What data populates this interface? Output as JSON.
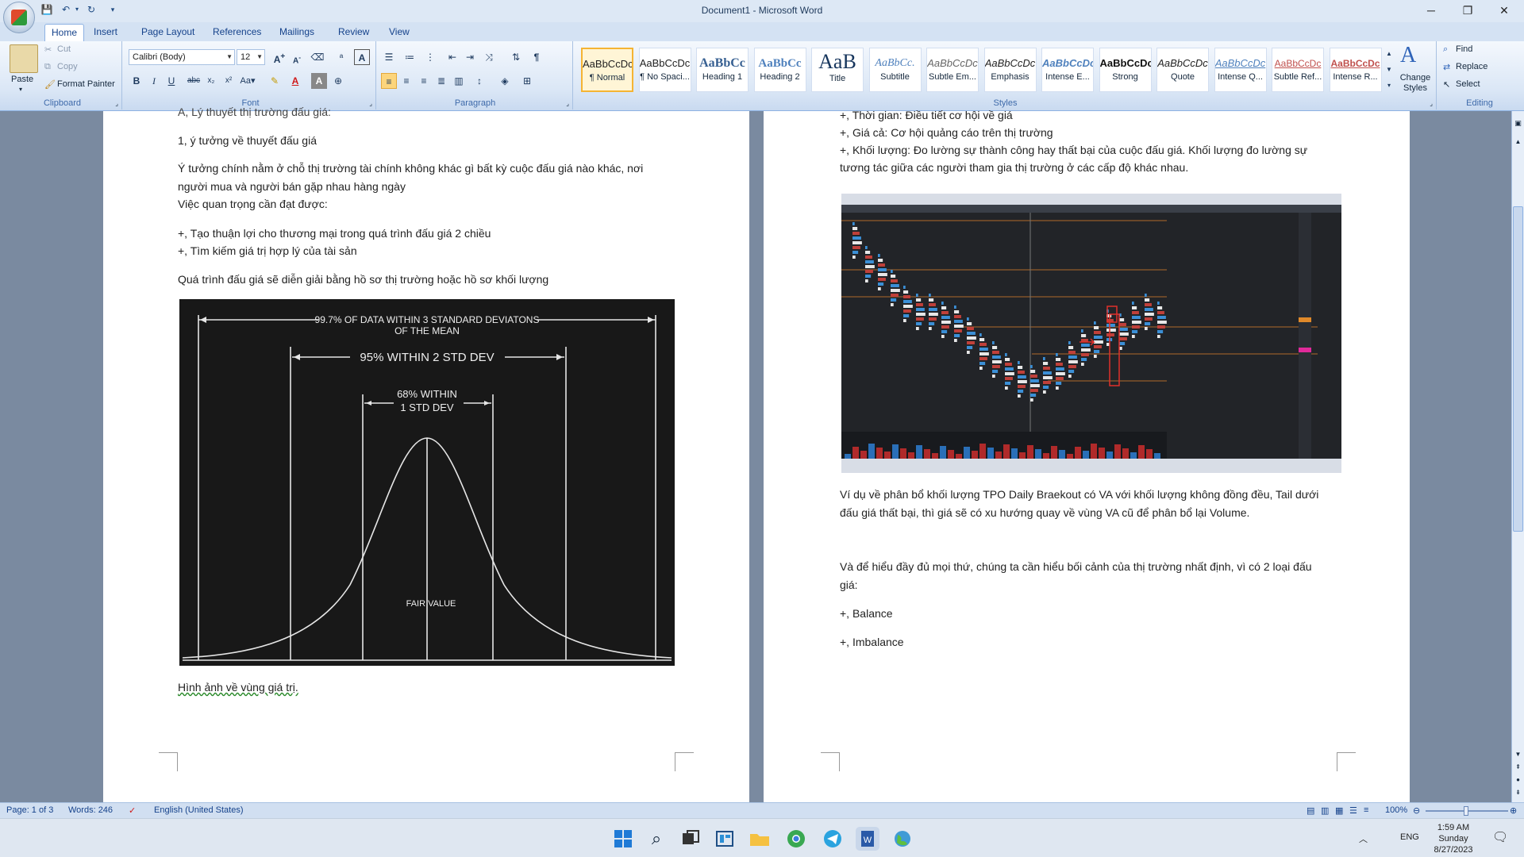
{
  "window": {
    "title": "Document1 - Microsoft Word",
    "minimize": "─",
    "restore": "❐",
    "close": "✕"
  },
  "tabs": [
    "Home",
    "Insert",
    "Page Layout",
    "References",
    "Mailings",
    "Review",
    "View"
  ],
  "clipboard": {
    "label": "Clipboard",
    "paste": "Paste",
    "cut": "Cut",
    "copy": "Copy",
    "format_painter": "Format Painter"
  },
  "font": {
    "label": "Font",
    "name": "Calibri (Body)",
    "size": "12"
  },
  "paragraph": {
    "label": "Paragraph"
  },
  "styles": {
    "label": "Styles",
    "change_styles": "Change Styles",
    "items": [
      {
        "preview": "AaBbCcDc",
        "name": "¶ Normal"
      },
      {
        "preview": "AaBbCcDc",
        "name": "¶ No Spaci..."
      },
      {
        "preview": "AaBbCc",
        "name": "Heading 1"
      },
      {
        "preview": "AaBbCc",
        "name": "Heading 2"
      },
      {
        "preview": "AaB",
        "name": "Title"
      },
      {
        "preview": "AaBbCc.",
        "name": "Subtitle"
      },
      {
        "preview": "AaBbCcDc",
        "name": "Subtle Em..."
      },
      {
        "preview": "AaBbCcDc",
        "name": "Emphasis"
      },
      {
        "preview": "AaBbCcDc",
        "name": "Intense E..."
      },
      {
        "preview": "AaBbCcDc",
        "name": "Strong"
      },
      {
        "preview": "AaBbCcDc",
        "name": "Quote"
      },
      {
        "preview": "AaBbCcDc",
        "name": "Intense Q..."
      },
      {
        "preview": "AaBbCcDc",
        "name": "Subtle Ref..."
      },
      {
        "preview": "AaBbCcDc",
        "name": "Intense R..."
      }
    ]
  },
  "editing": {
    "label": "Editing",
    "find": "Find",
    "replace": "Replace",
    "select": "Select"
  },
  "page1": {
    "cutoff": "A, Lý thuyết thị trường đấu giá:",
    "p1": "1, ý tưởng về thuyết  đấu giá",
    "p2a": " Ý tưởng chính nằm ở chỗ thị trường tài chính không khác gì bất kỳ cuộc đấu giá nào khác, nơi",
    "p2b": "người mua và người bán gặp nhau hàng ngày",
    "p3": " Việc quan trọng cần đạt được:",
    "p4": "+, Tạo thuận lợi cho thương mại trong quá trình đấu giá 2 chiều",
    "p5": "+, Tìm kiếm giá trị hợp lý của tài sản",
    "p6": "Quá trình đấu giá sẽ diễn giải bằng hồ sơ thị trường hoặc hồ sơ khối lượng",
    "caption": "Hình ảnh về vùng giá trị.",
    "figure": {
      "l1a": "99.7% OF DATA WITHIN 3 STANDARD DEVIATONS",
      "l1b": "OF THE MEAN",
      "l2": "95% WITHIN 2 STD DEV",
      "l3a": "68% WITHIN",
      "l3b": "1 STD DEV",
      "fair": "FAIR VALUE"
    }
  },
  "page2": {
    "p1": "+, Thời gian: Điều tiết cơ hội về giá",
    "p2": "+, Giá cả: Cơ hội  quảng cáo trên thị trường",
    "p3a": "+, Khối lượng: Đo lường sự thành công hay thất bại của cuộc đấu giá. Khối lượng đo lường sự",
    "p3b": "tương tác giữa các người tham gia thị trường ở các cấp độ khác nhau.",
    "p4a": "Ví dụ về phân bổ khối lượng TPO Daily Braekout có VA với khối lượng không  đồng đều, Tail dưới",
    "p4b": "đấu giá thất bại, thì giá sẽ có xu hướng quay về vùng VA cũ để phân bổ lại Volume.",
    "p5a": "Và để hiểu đầy đủ mọi thứ, chúng ta cần hiểu bối cảnh của thị trường nhất định, vì có 2 loại đấu",
    "p5b": "giá:",
    "p6": "+, Balance",
    "p7": "+, Imbalance"
  },
  "status": {
    "page": "Page: 1 of 3",
    "words": "Words: 246",
    "language": "English (United States)",
    "zoom": "100%"
  },
  "taskbar": {
    "lang": "ENG",
    "time": "1:59 AM",
    "day": "Sunday",
    "date": "8/27/2023"
  }
}
